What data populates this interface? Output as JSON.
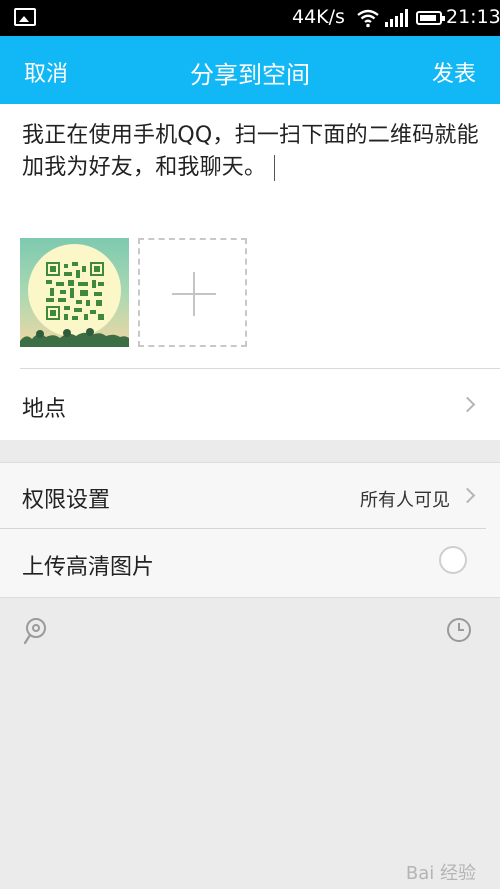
{
  "status_bar": {
    "net_speed": "44K/s",
    "time": "21:13"
  },
  "header": {
    "cancel_label": "取消",
    "title": "分享到空间",
    "publish_label": "发表",
    "bg_color": "#12b7f5"
  },
  "compose": {
    "message_text": "我正在使用手机QQ，扫一扫下面的二维码就能加我为好友，和我聊天。",
    "attachment_icon": "qr-code-thumbnail",
    "add_icon": "plus-icon"
  },
  "location": {
    "label": "地点"
  },
  "settings": {
    "permission_label": "权限设置",
    "permission_value": "所有人可见",
    "hd_upload_label": "上传高清图片"
  },
  "watermark": {
    "text": "Bai 经验"
  }
}
